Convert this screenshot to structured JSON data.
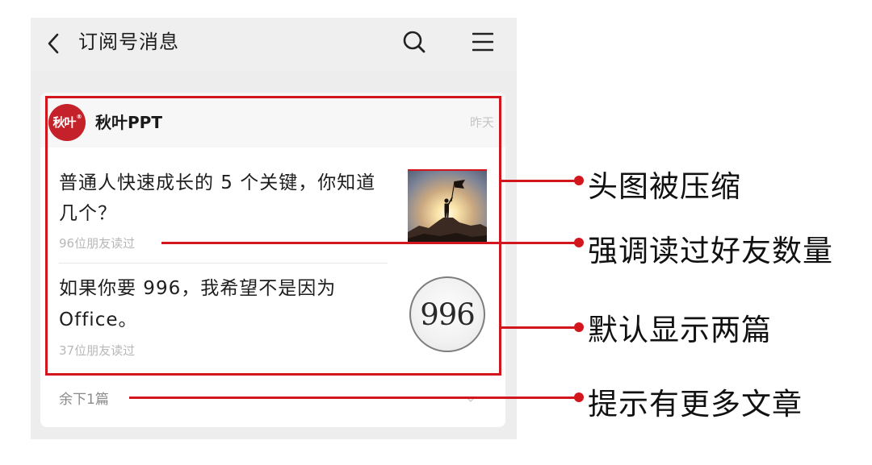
{
  "header": {
    "title": "订阅号消息",
    "back_icon": "chevron-left-icon",
    "search_icon": "search-icon",
    "menu_icon": "menu-icon"
  },
  "account": {
    "avatar_text": "秋叶",
    "avatar_mark": "®",
    "name": "秋叶PPT",
    "time": "昨天"
  },
  "articles": [
    {
      "title_lines": [
        "普通人快速成长的 5 个关键，你知道",
        "几个？"
      ],
      "read_count": "96位朋友读过"
    },
    {
      "title_lines": [
        "如果你要 996，我希望不是因为",
        "Office。"
      ],
      "read_count": "37位朋友读过",
      "thumbnail_text": "996"
    }
  ],
  "more": {
    "label": "余下1篇",
    "icon": "chevron-down-icon"
  },
  "annotations": [
    {
      "label": "头图被压缩"
    },
    {
      "label": "强调读过好友数量"
    },
    {
      "label": "默认显示两篇"
    },
    {
      "label": "提示有更多文章"
    }
  ],
  "colors": {
    "annotation_red": "#d3161e",
    "avatar_red": "#c5212a",
    "panel_gray": "#ededed"
  }
}
